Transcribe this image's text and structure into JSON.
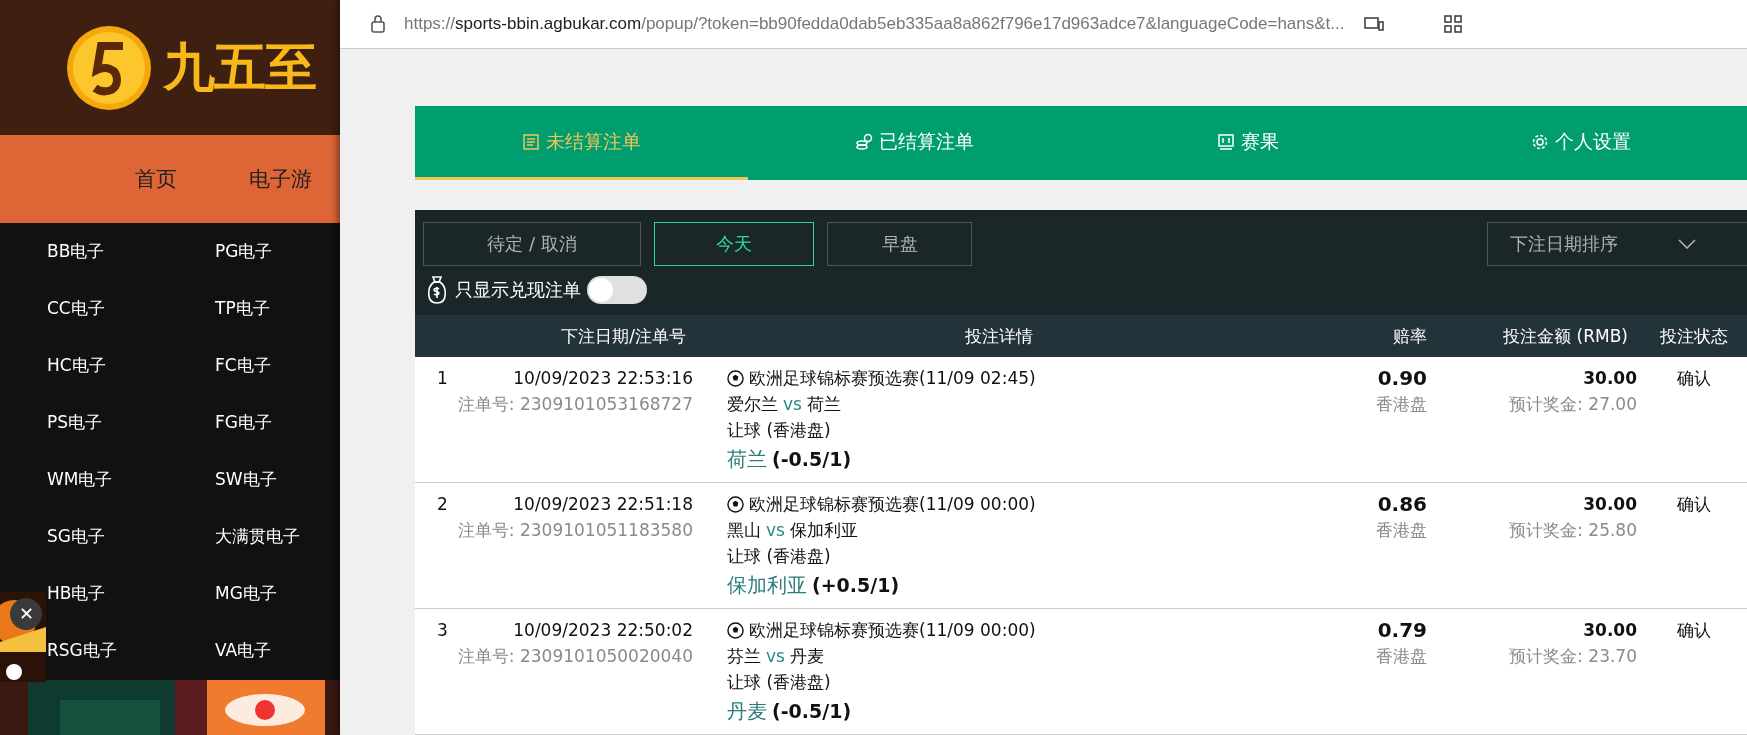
{
  "site": {
    "logo_text": "九五至",
    "nav": [
      "首页",
      "电子游"
    ],
    "menu": [
      "BB电子",
      "PG电子",
      "CC电子",
      "TP电子",
      "HC电子",
      "FC电子",
      "PS电子",
      "FG电子",
      "WM电子",
      "SW电子",
      "SG电子",
      "大满贯电子",
      "HB电子",
      "MG电子",
      "RSG电子",
      "VA电子"
    ],
    "close_button": "✕"
  },
  "popup": {
    "address_bar": {
      "scheme": "https://",
      "host": "sports-bbin.agbukar.com",
      "path": "/popup/?token=bb90fedda0dab5eb335aa8a862f796e17d963adce7&languageCode=hans&t..."
    },
    "tabs": [
      {
        "label": "未结算注单",
        "kind": "list",
        "selected": true
      },
      {
        "label": "已结算注单",
        "kind": "coins",
        "selected": false
      },
      {
        "label": "赛果",
        "kind": "board",
        "selected": false
      },
      {
        "label": "个人设置",
        "kind": "gear",
        "selected": false
      }
    ],
    "filters": [
      {
        "label": "待定 / 取消",
        "selected": false
      },
      {
        "label": "今天",
        "selected": true
      },
      {
        "label": "早盘",
        "selected": false
      }
    ],
    "sort_select": {
      "value": "下注日期排序"
    },
    "cashout_toggle": {
      "label": "只显示兑现注单",
      "on": false
    },
    "table": {
      "columns": [
        "下注日期/注单号",
        "投注详情",
        "赔率",
        "投注金额 (RMB)",
        "投注状态"
      ],
      "rows": [
        {
          "index": "1",
          "date": "10/09/2023 22:53:16",
          "order_no": "注单号: 2309101053168727",
          "league": "欧洲足球锦标赛预选赛(11/09 02:45)",
          "home": "爱尔兰",
          "vs": "vs",
          "away": "荷兰",
          "market": "让球 (香港盘)",
          "pick": "荷兰",
          "handicap": "(-0.5/1)",
          "odds": "0.90",
          "odds_type": "香港盘",
          "stake": "30.00",
          "payout": "预计奖金: 27.00",
          "status": "确认"
        },
        {
          "index": "2",
          "date": "10/09/2023 22:51:18",
          "order_no": "注单号: 2309101051183580",
          "league": "欧洲足球锦标赛预选赛(11/09 00:00)",
          "home": "黑山",
          "vs": "vs",
          "away": "保加利亚",
          "market": "让球 (香港盘)",
          "pick": "保加利亚",
          "handicap": "(+0.5/1)",
          "odds": "0.86",
          "odds_type": "香港盘",
          "stake": "30.00",
          "payout": "预计奖金: 25.80",
          "status": "确认"
        },
        {
          "index": "3",
          "date": "10/09/2023 22:50:02",
          "order_no": "注单号: 2309101050020040",
          "league": "欧洲足球锦标赛预选赛(11/09 00:00)",
          "home": "芬兰",
          "vs": "vs",
          "away": "丹麦",
          "market": "让球 (香港盘)",
          "pick": "丹麦",
          "handicap": "(-0.5/1)",
          "odds": "0.79",
          "odds_type": "香港盘",
          "stake": "30.00",
          "payout": "预计奖金: 23.70",
          "status": "确认"
        }
      ]
    }
  }
}
